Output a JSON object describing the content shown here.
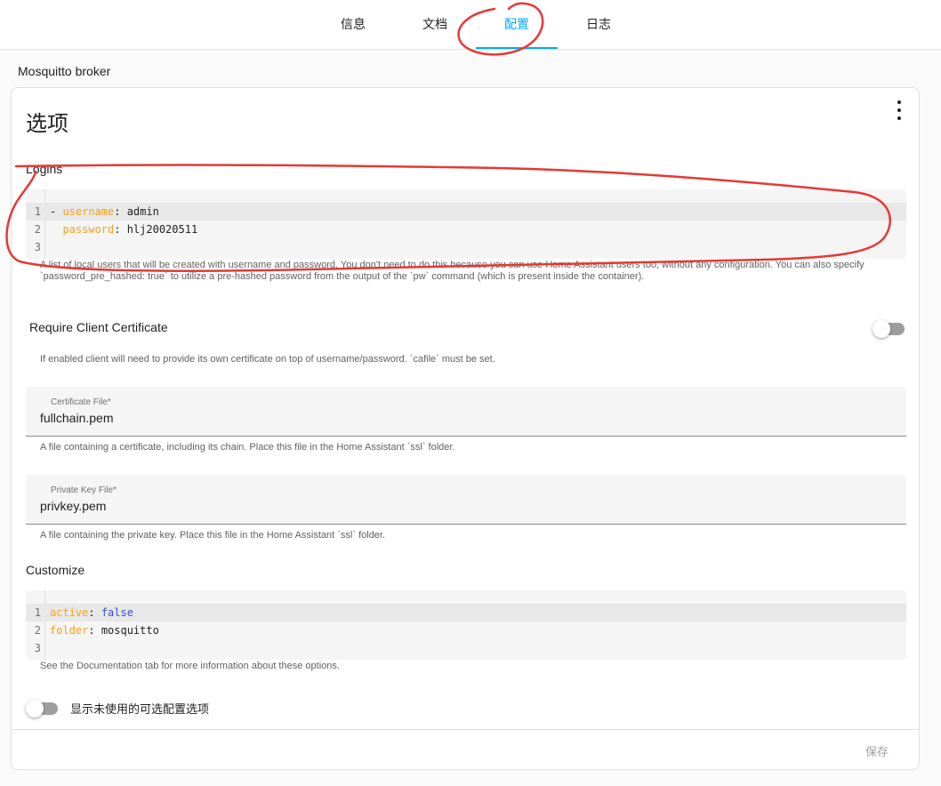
{
  "tabs": [
    {
      "label": "信息",
      "active": false
    },
    {
      "label": "文档",
      "active": false
    },
    {
      "label": "配置",
      "active": true
    },
    {
      "label": "日志",
      "active": false
    }
  ],
  "addon_name": "Mosquitto broker",
  "card": {
    "title": "选项",
    "menu_icon": "dots-vertical-icon",
    "logins": {
      "label": "Logins",
      "code_lines": [
        {
          "num": "1",
          "marker": "- ",
          "key": "username",
          "sep": ": ",
          "value": "admin"
        },
        {
          "num": "2",
          "marker": "  ",
          "key": "password",
          "sep": ": ",
          "value": "hlj20020511"
        },
        {
          "num": "3"
        }
      ],
      "helper": "A list of local users that will be created with username and password. You don't need to do this because you can use Home Assistant users too, without any configuration. You can also specify `password_pre_hashed: true` to utilize a pre-hashed password from the output of the `pw` command (which is present inside the container)."
    },
    "require_cert": {
      "label": "Require Client Certificate",
      "enabled": false,
      "helper": "If enabled client will need to provide its own certificate on top of username/password. `cafile` must be set."
    },
    "cert_file": {
      "label": "Certificate File*",
      "value": "fullchain.pem",
      "helper": "A file containing a certificate, including its chain. Place this file in the Home Assistant `ssl` folder."
    },
    "key_file": {
      "label": "Private Key File*",
      "value": "privkey.pem",
      "helper": "A file containing the private key. Place this file in the Home Assistant `ssl` folder."
    },
    "customize": {
      "label": "Customize",
      "code_lines": [
        {
          "num": "1",
          "key": "active",
          "sep": ": ",
          "value": "false"
        },
        {
          "num": "2",
          "key": "folder",
          "sep": ": ",
          "value": "mosquitto"
        },
        {
          "num": "3"
        }
      ],
      "helper": "See the Documentation tab for more information about these options."
    },
    "show_unused": {
      "label": "显示未使用的可选配置选项",
      "enabled": false
    },
    "save_label": "保存"
  },
  "colors": {
    "accent": "#03a9f4",
    "annotation": "#e53935",
    "yaml_key": "#f4a11d",
    "yaml_bool": "#3b4dd3"
  }
}
